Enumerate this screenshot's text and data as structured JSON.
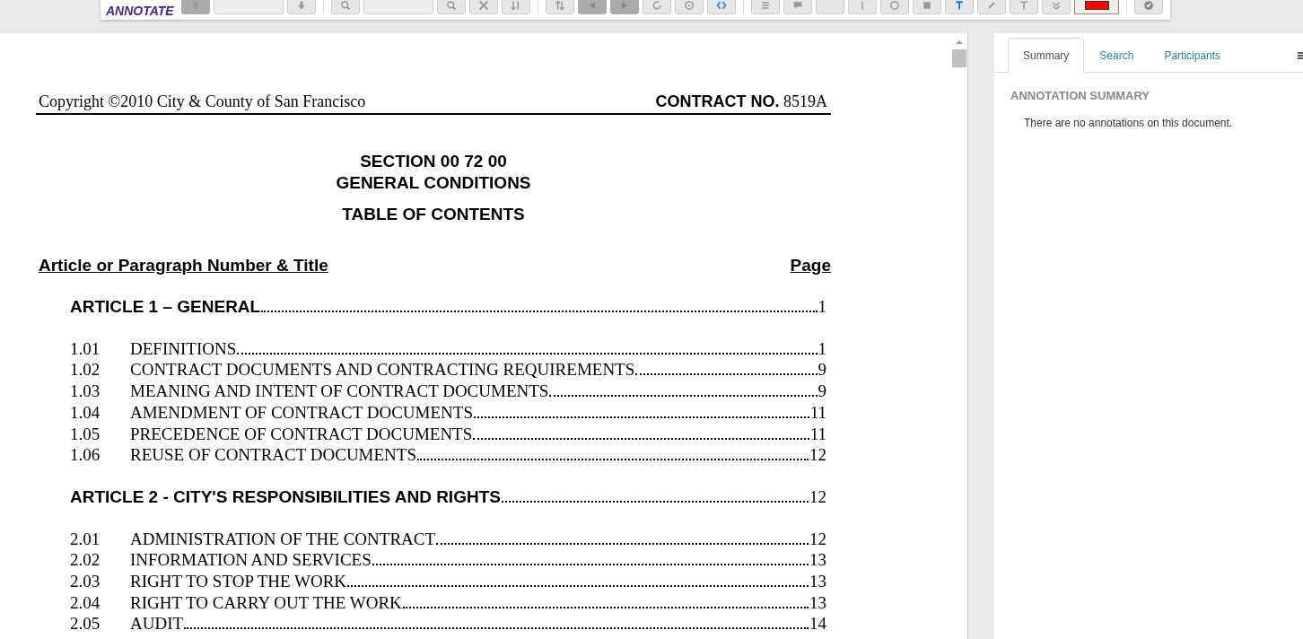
{
  "toolbar": {
    "logo": "ANNOTATE",
    "items": [
      {
        "kind": "button",
        "disabled": true
      },
      {
        "kind": "field"
      },
      {
        "kind": "button",
        "disabled": false
      },
      {
        "kind": "separator"
      },
      {
        "kind": "button",
        "disabled": false
      },
      {
        "kind": "field"
      },
      {
        "kind": "button",
        "disabled": false
      },
      {
        "kind": "button",
        "disabled": false
      },
      {
        "kind": "button",
        "disabled": false
      },
      {
        "kind": "separator"
      },
      {
        "kind": "button",
        "disabled": false
      },
      {
        "kind": "button",
        "disabled": true
      },
      {
        "kind": "button",
        "disabled": true
      },
      {
        "kind": "button",
        "disabled": false
      },
      {
        "kind": "button",
        "disabled": false
      },
      {
        "kind": "button",
        "disabled": false
      },
      {
        "kind": "separator"
      },
      {
        "kind": "button",
        "disabled": false
      },
      {
        "kind": "button",
        "disabled": false
      },
      {
        "kind": "button",
        "disabled": false
      },
      {
        "kind": "button",
        "disabled": false
      },
      {
        "kind": "button",
        "disabled": false
      },
      {
        "kind": "button",
        "disabled": false
      },
      {
        "kind": "button",
        "disabled": false
      },
      {
        "kind": "button",
        "disabled": false
      },
      {
        "kind": "button",
        "disabled": false
      },
      {
        "kind": "button",
        "disabled": false
      },
      {
        "kind": "color",
        "color": "#ff0000"
      },
      {
        "kind": "separator"
      },
      {
        "kind": "button",
        "disabled": false
      }
    ]
  },
  "document": {
    "header_left": "Copyright ©2010 City & County of San Francisco",
    "header_right_label": "CONTRACT NO.",
    "header_right_number": "8519A",
    "section": "SECTION 00 72 00",
    "title": "GENERAL CONDITIONS",
    "subtitle": "TABLE OF CONTENTS",
    "column_left": "Article or Paragraph Number & Title",
    "column_right": "Page",
    "entries": [
      {
        "kind": "article",
        "title": "ARTICLE 1 – GENERAL",
        "page": "1"
      },
      {
        "kind": "item",
        "number": "1.01",
        "title": "DEFINITIONS",
        "page": "1"
      },
      {
        "kind": "item",
        "number": "1.02",
        "title": "CONTRACT DOCUMENTS AND CONTRACTING REQUIREMENTS",
        "page": "9"
      },
      {
        "kind": "item",
        "number": "1.03",
        "title": "MEANING AND INTENT OF CONTRACT DOCUMENTS",
        "page": "9"
      },
      {
        "kind": "item",
        "number": "1.04",
        "title": "AMENDMENT OF CONTRACT DOCUMENTS",
        "page": "11"
      },
      {
        "kind": "item",
        "number": "1.05",
        "title": "PRECEDENCE OF CONTRACT DOCUMENTS",
        "page": "11"
      },
      {
        "kind": "item",
        "number": "1.06",
        "title": "REUSE OF CONTRACT DOCUMENTS",
        "page": "12"
      },
      {
        "kind": "article",
        "title": "ARTICLE 2 - CITY'S RESPONSIBILITIES AND RIGHTS",
        "page": "12"
      },
      {
        "kind": "item",
        "number": "2.01",
        "title": "ADMINISTRATION OF THE CONTRACT",
        "page": "12"
      },
      {
        "kind": "item",
        "number": "2.02",
        "title": "INFORMATION AND SERVICES",
        "page": "13"
      },
      {
        "kind": "item",
        "number": "2.03",
        "title": "RIGHT TO STOP THE WORK",
        "page": "13"
      },
      {
        "kind": "item",
        "number": "2.04",
        "title": "RIGHT TO CARRY OUT THE WORK",
        "page": "13"
      },
      {
        "kind": "item",
        "number": "2.05",
        "title": "AUDIT",
        "page": "14"
      }
    ]
  },
  "sidebar": {
    "tabs": [
      {
        "label": "Summary",
        "selected": true
      },
      {
        "label": "Search",
        "selected": false
      },
      {
        "label": "Participants",
        "selected": false
      }
    ],
    "heading": "ANNOTATION SUMMARY",
    "message": "There are no annotations on this document."
  }
}
